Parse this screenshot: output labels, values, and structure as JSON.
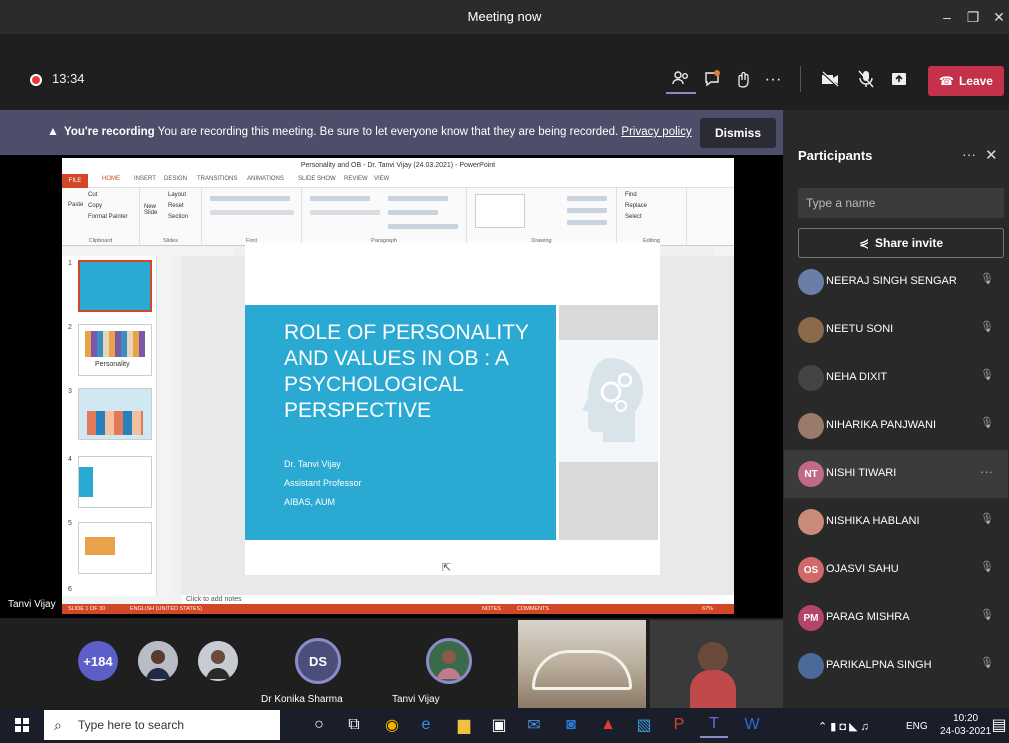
{
  "window": {
    "title": "Meeting now"
  },
  "meeting": {
    "timer": "13:34",
    "leave_label": "Leave",
    "banner_title": "You're recording",
    "banner_text": "You are recording this meeting. Be sure to let everyone know that they are being recorded.",
    "banner_link": "Privacy policy",
    "dismiss_label": "Dismiss",
    "presenter_name": "Tanvi Vijay",
    "gallery": {
      "overflow_count": "+184",
      "ds_initials": "DS",
      "ds_name": "Dr Konika Sharma",
      "tv_name": "Tanvi Vijay"
    }
  },
  "powerpoint": {
    "title": "Personality and OB - Dr. Tanvi Vijay (24.03.2021) - PowerPoint",
    "tabs": [
      "FILE",
      "HOME",
      "INSERT",
      "DESIGN",
      "TRANSITIONS",
      "ANIMATIONS",
      "SLIDE SHOW",
      "REVIEW",
      "VIEW"
    ],
    "ribbon_groups": [
      "Clipboard",
      "Slides",
      "Font",
      "Paragraph",
      "Drawing",
      "Editing"
    ],
    "clipboard": {
      "cut": "Cut",
      "copy": "Copy",
      "format_painter": "Format Painter",
      "paste": "Paste"
    },
    "slides_group": {
      "new_slide": "New Slide",
      "layout": "Layout",
      "reset": "Reset",
      "section": "Section"
    },
    "editing": {
      "find": "Find",
      "replace": "Replace",
      "select": "Select"
    },
    "notes_placeholder": "Click to add notes",
    "status": {
      "slide": "SLIDE 1 OF 30",
      "language": "ENGLISH (UNITED STATES)",
      "notes": "NOTES",
      "comments": "COMMENTS",
      "zoom": "67%"
    },
    "thumbnails": [
      "1",
      "2",
      "3",
      "4",
      "5",
      "6"
    ],
    "thumb2_caption": "Personality",
    "slide": {
      "title": "ROLE OF PERSONALITY AND VALUES IN OB : A PSYCHOLOGICAL PERSPECTIVE",
      "author": "Dr. Tanvi Vijay",
      "role": "Assistant Professor",
      "institution": "AIBAS, AUM"
    }
  },
  "participants": {
    "title": "Participants",
    "search_placeholder": "Type a name",
    "share_label": "Share invite",
    "list": [
      {
        "name": "NEERAJ SINGH SENGAR",
        "initials": "",
        "color": "#6a7fa8"
      },
      {
        "name": "NEETU SONI",
        "initials": "",
        "color": "#8a6a4a"
      },
      {
        "name": "NEHA DIXIT",
        "initials": "",
        "color": "#444444"
      },
      {
        "name": "NIHARIKA PANJWANI",
        "initials": "",
        "color": "#9a7b6a"
      },
      {
        "name": "NISHI TIWARI",
        "initials": "NT",
        "color": "#c06a8a"
      },
      {
        "name": "NISHIKA HABLANI",
        "initials": "",
        "color": "#c98a7a"
      },
      {
        "name": "OJASVI SAHU",
        "initials": "OS",
        "color": "#d06a6a"
      },
      {
        "name": "PARAG MISHRA",
        "initials": "PM",
        "color": "#b3456a"
      },
      {
        "name": "PARIKALPNA SINGH",
        "initials": "",
        "color": "#4a6a9a"
      }
    ]
  },
  "taskbar": {
    "search_placeholder": "Type here to search",
    "lang": "ENG",
    "time": "10:20",
    "date": "24-03-2021"
  },
  "colors": {
    "leave": "#c4314b",
    "banner": "#4c4e6a",
    "slide_blue": "#2aa9d2",
    "ppt_orange": "#d24726"
  }
}
